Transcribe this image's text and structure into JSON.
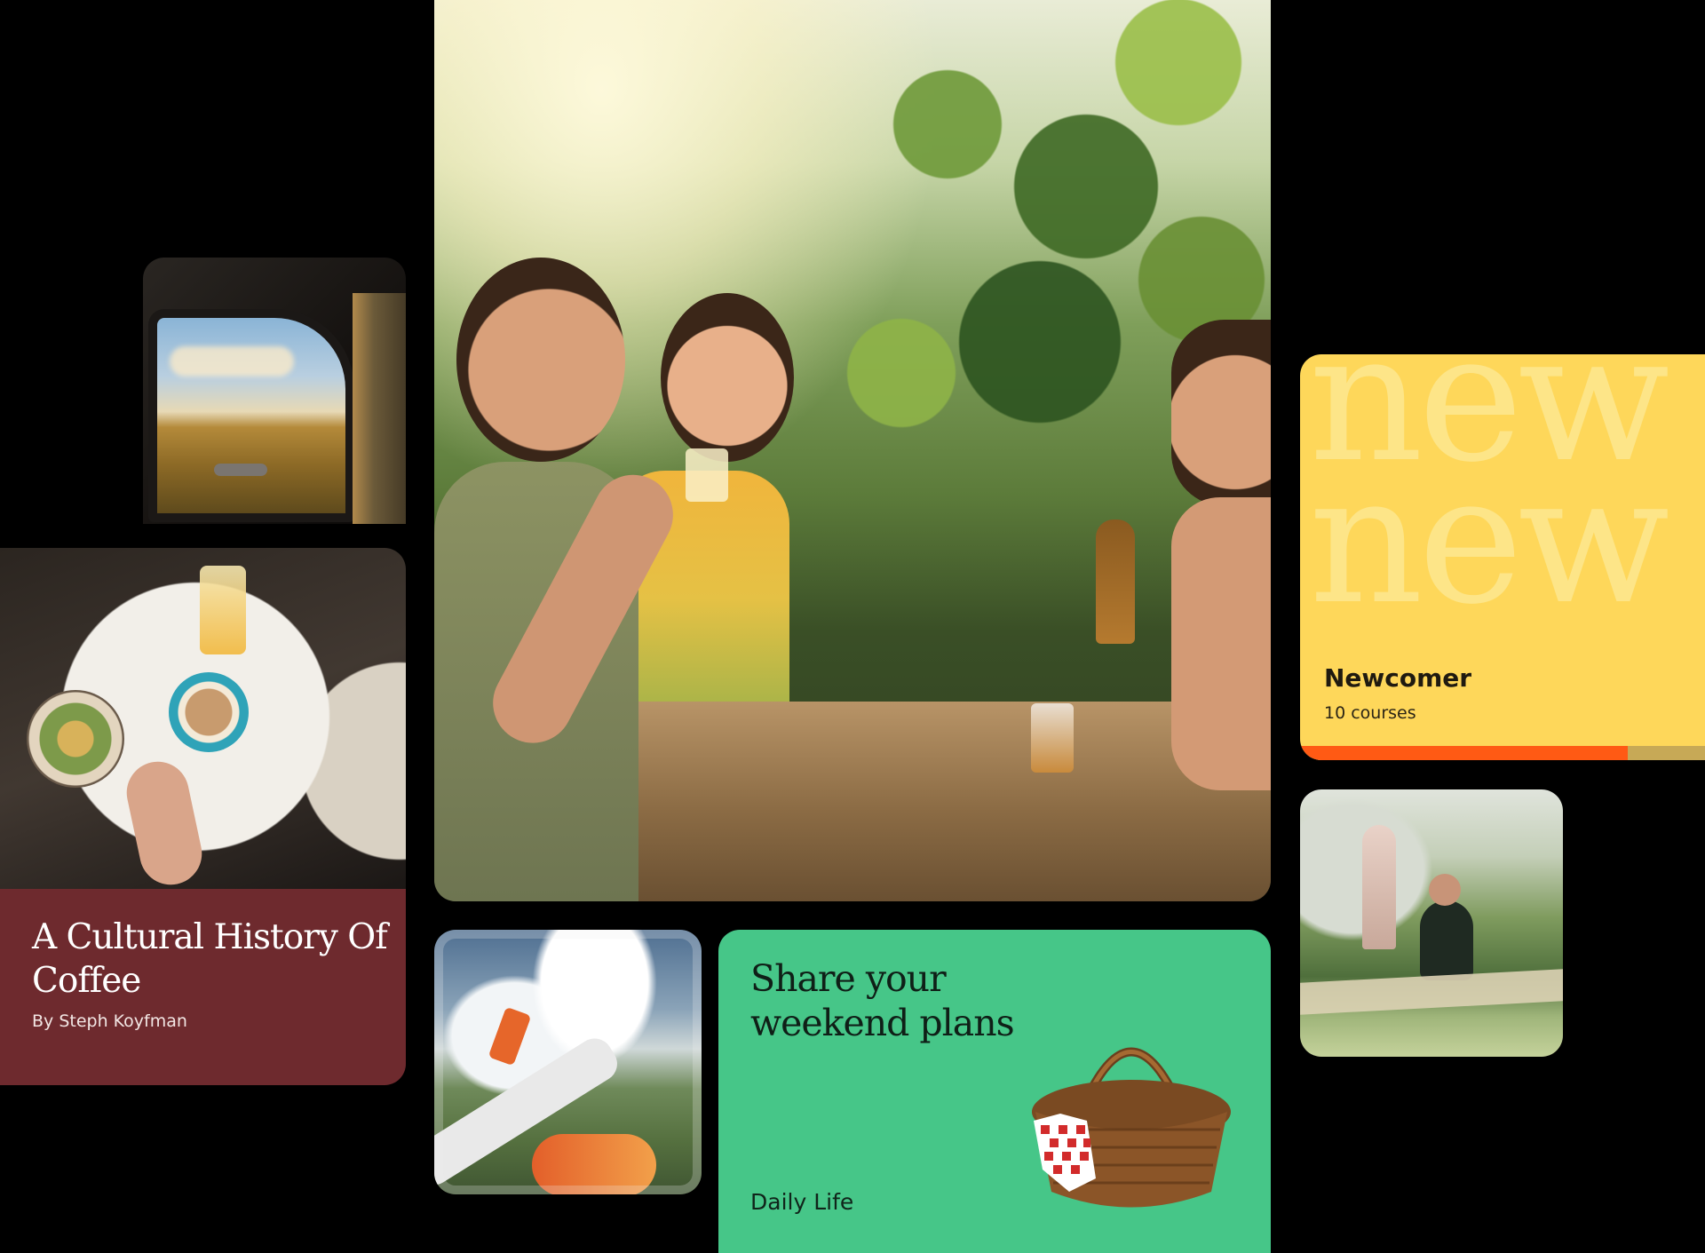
{
  "cards": {
    "coffee": {
      "title": "A Cultural History Of Coffee",
      "author": "By Steph Koyfman",
      "background_color": "#6e2a2e"
    },
    "weekend": {
      "title": "Share your weekend plans",
      "tag": "Daily Life",
      "background_color": "#46c688"
    },
    "newcomer": {
      "watermark": "new\nnew",
      "title": "Newcomer",
      "count": "10 courses",
      "progress": 0.81,
      "background_color": "#fed75a",
      "progress_color": "#ff5a14"
    }
  },
  "photos": {
    "car": "car-window-photo",
    "main": "friends-drinking-outdoors-photo",
    "plane": "airplane-window-photo",
    "park": "park-bench-photo",
    "coffee": "cafe-table-photo"
  }
}
